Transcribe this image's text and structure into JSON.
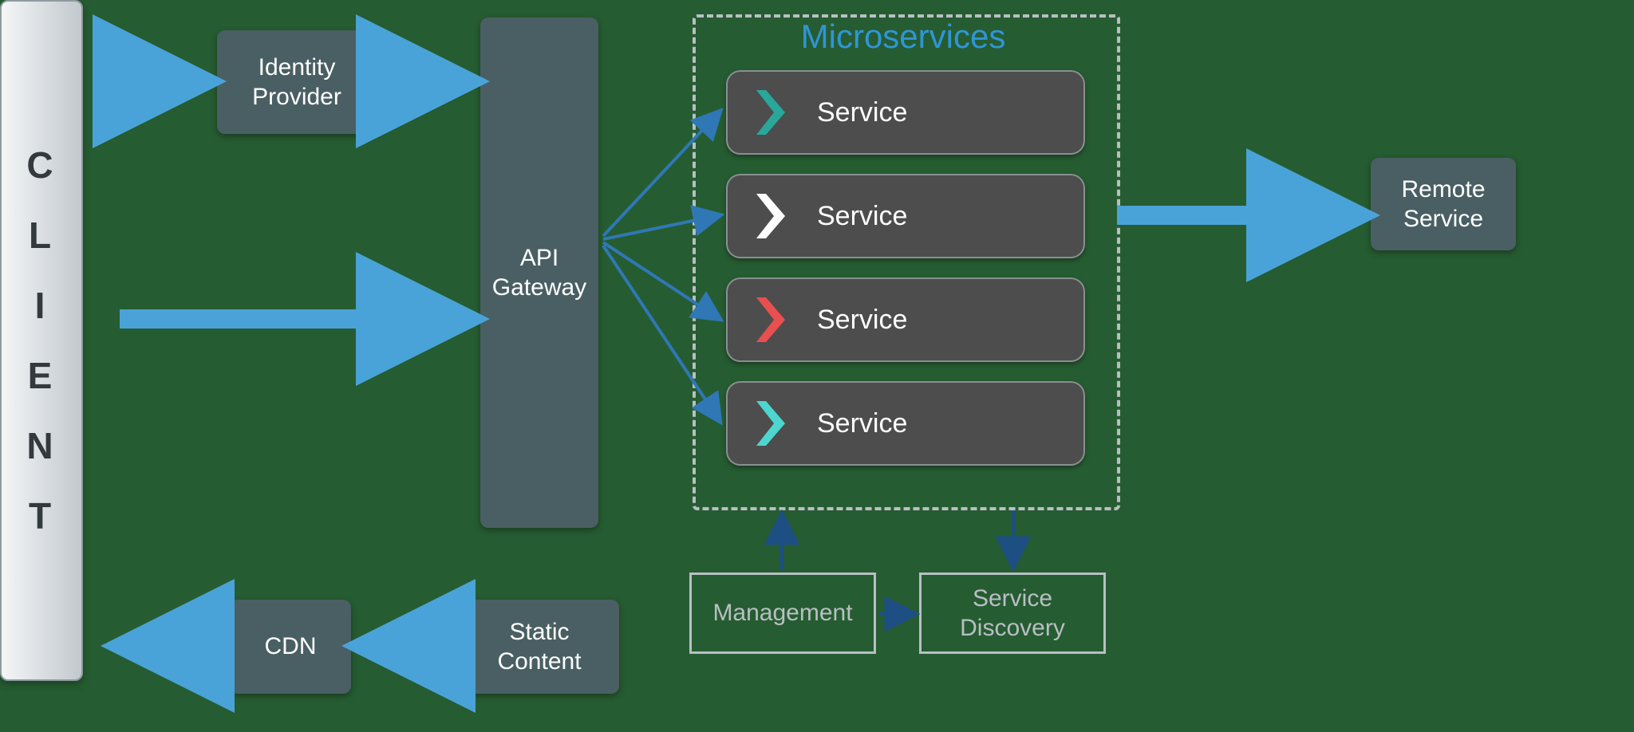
{
  "client": {
    "label": "CLIENT"
  },
  "identity_provider": {
    "label": "Identity\nProvider"
  },
  "api_gateway": {
    "label": "API\nGateway"
  },
  "cdn": {
    "label": "CDN"
  },
  "static_content": {
    "label": "Static\nContent"
  },
  "remote_service": {
    "label": "Remote\nService"
  },
  "microservices": {
    "title": "Microservices",
    "services": [
      {
        "label": "Service",
        "chevron_color": "#2aa79b"
      },
      {
        "label": "Service",
        "chevron_color": "#ffffff"
      },
      {
        "label": "Service",
        "chevron_color": "#e94f4f"
      },
      {
        "label": "Service",
        "chevron_color": "#4dd6cf"
      }
    ]
  },
  "management": {
    "label": "Management"
  },
  "service_discovery": {
    "label": "Service\nDiscovery"
  },
  "colors": {
    "arrow_light": "#4aa3d8",
    "arrow_thin": "#2f78b5",
    "arrow_dark": "#1d4f82"
  }
}
